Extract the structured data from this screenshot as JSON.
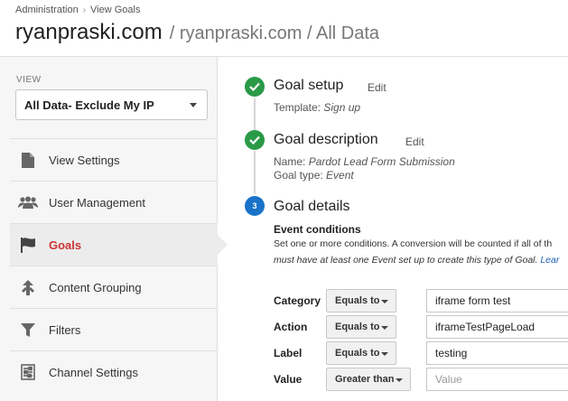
{
  "breadcrumb": {
    "root": "Administration",
    "separator": "›",
    "current": "View Goals"
  },
  "header": {
    "property": "ryanpraski.com",
    "path": "/ ryanpraski.com / All Data"
  },
  "sidebar": {
    "view_label": "VIEW",
    "view_selected": "All Data- Exclude My IP",
    "items": [
      {
        "label": "View Settings",
        "icon": "document-icon"
      },
      {
        "label": "User Management",
        "icon": "users-icon"
      },
      {
        "label": "Goals",
        "icon": "flag-icon",
        "active": true
      },
      {
        "label": "Content Grouping",
        "icon": "content-grouping-icon"
      },
      {
        "label": "Filters",
        "icon": "funnel-icon"
      },
      {
        "label": "Channel Settings",
        "icon": "sliders-icon"
      }
    ]
  },
  "steps": {
    "setup": {
      "title": "Goal setup",
      "edit": "Edit",
      "template_key": "Template:",
      "template_value": "Sign up"
    },
    "description": {
      "title": "Goal description",
      "edit": "Edit",
      "name_key": "Name:",
      "name_value": "Pardot Lead Form Submission",
      "type_key": "Goal type:",
      "type_value": "Event"
    },
    "details": {
      "number": "3",
      "title": "Goal details",
      "event_conditions": "Event conditions",
      "line1": "Set one or more conditions. A conversion will be counted if all of th",
      "line2": "must have at least one Event set up to create this type of Goal.",
      "line2_link": "Lear",
      "conditions": [
        {
          "label": "Category",
          "operator": "Equals to",
          "value": "iframe form test",
          "placeholder": ""
        },
        {
          "label": "Action",
          "operator": "Equals to",
          "value": "iframeTestPageLoad",
          "placeholder": ""
        },
        {
          "label": "Label",
          "operator": "Equals to",
          "value": "testing",
          "placeholder": ""
        },
        {
          "label": "Value",
          "operator": "Greater than",
          "value": "",
          "placeholder": "Value"
        }
      ]
    }
  },
  "colors": {
    "accent_green": "#2a9a47",
    "accent_blue": "#1a73c9",
    "active_red": "#cc3333"
  }
}
